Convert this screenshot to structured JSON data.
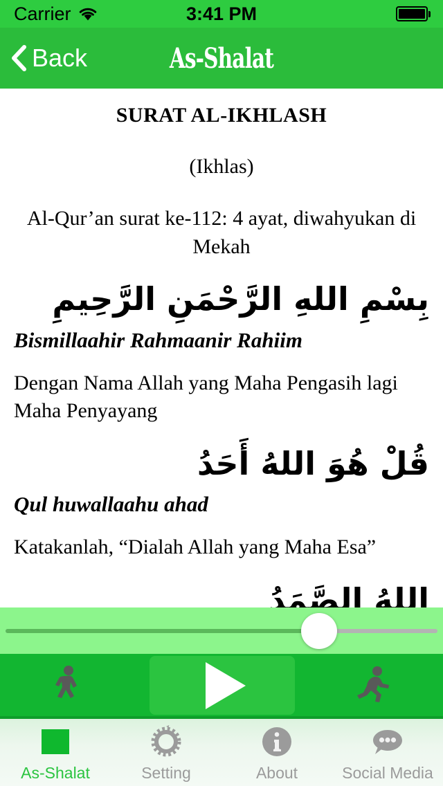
{
  "statusbar": {
    "carrier": "Carrier",
    "wifi_icon": "wifi-icon",
    "time": "3:41 PM",
    "battery_icon": "battery-full-icon"
  },
  "navbar": {
    "back_label": "Back",
    "back_icon": "chevron-left-icon",
    "title": "As-Shalat"
  },
  "content": {
    "surat_title": "SURAT AL-IKHLASH",
    "surat_alt": "(Ikhlas)",
    "surat_meta": "Al-Qur’an surat ke-112: 4 ayat, diwahyukan di Mekah",
    "verses": [
      {
        "arabic": "بِسْمِ اللهِ الرَّحْمَنِ الرَّحِيمِ",
        "translit": "Bismillaahir Rahmaanir Rahiim",
        "meaning": "Dengan Nama Allah yang Maha Pengasih lagi Maha Penyayang"
      },
      {
        "arabic": "قُلْ هُوَ اللهُ أَحَدُ",
        "translit": "Qul huwallaahu ahad",
        "meaning": "Katakanlah, “Dialah Allah yang Maha Esa”"
      },
      {
        "arabic": "اللهُ الصَّمَدُ",
        "translit": "",
        "meaning": ""
      }
    ]
  },
  "player": {
    "slider_value_percent": 72,
    "slow_icon": "walking-person-icon",
    "play_icon": "play-icon",
    "fast_icon": "running-person-icon"
  },
  "tabbar": {
    "items": [
      {
        "label": "As-Shalat",
        "icon": "green-square-icon",
        "active": true
      },
      {
        "label": "Setting",
        "icon": "gear-icon",
        "active": false
      },
      {
        "label": "About",
        "icon": "info-circle-icon",
        "active": false
      },
      {
        "label": "Social Media",
        "icon": "speech-bubble-icon",
        "active": false
      }
    ]
  },
  "colors": {
    "statusbar_green": "#2ECC40",
    "navbar_green": "#2BBC3B",
    "slider_panel_green": "#8CF58C",
    "player_green": "#12B631",
    "play_button_green": "#2BC440",
    "tab_active_green": "#2BC440",
    "tab_inactive_gray": "#9B9B9B"
  }
}
